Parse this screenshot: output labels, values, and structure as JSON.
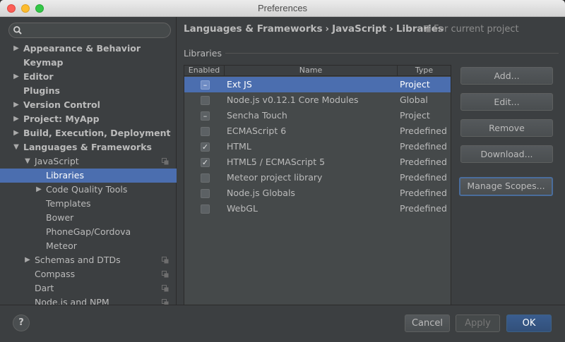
{
  "window": {
    "title": "Preferences"
  },
  "search": {
    "placeholder": "",
    "value": ""
  },
  "sidebar": {
    "items": [
      {
        "label": "Appearance & Behavior",
        "arrow": "▶",
        "bold": true,
        "indent": 0
      },
      {
        "label": "Keymap",
        "arrow": "",
        "bold": true,
        "indent": 0
      },
      {
        "label": "Editor",
        "arrow": "▶",
        "bold": true,
        "indent": 0
      },
      {
        "label": "Plugins",
        "arrow": "",
        "bold": true,
        "indent": 0
      },
      {
        "label": "Version Control",
        "arrow": "▶",
        "bold": true,
        "indent": 0
      },
      {
        "label": "Project: MyApp",
        "arrow": "▶",
        "bold": true,
        "indent": 0
      },
      {
        "label": "Build, Execution, Deployment",
        "arrow": "▶",
        "bold": true,
        "indent": 0
      },
      {
        "label": "Languages & Frameworks",
        "arrow": "▼",
        "bold": true,
        "indent": 0
      },
      {
        "label": "JavaScript",
        "arrow": "▼",
        "bold": false,
        "indent": 1,
        "scope": true
      },
      {
        "label": "Libraries",
        "arrow": "",
        "bold": false,
        "indent": 2,
        "selected": true
      },
      {
        "label": "Code Quality Tools",
        "arrow": "▶",
        "bold": false,
        "indent": 2
      },
      {
        "label": "Templates",
        "arrow": "",
        "bold": false,
        "indent": 2
      },
      {
        "label": "Bower",
        "arrow": "",
        "bold": false,
        "indent": 2
      },
      {
        "label": "PhoneGap/Cordova",
        "arrow": "",
        "bold": false,
        "indent": 2
      },
      {
        "label": "Meteor",
        "arrow": "",
        "bold": false,
        "indent": 2
      },
      {
        "label": "Schemas and DTDs",
        "arrow": "▶",
        "bold": false,
        "indent": 1,
        "scope": true
      },
      {
        "label": "Compass",
        "arrow": "",
        "bold": false,
        "indent": 1,
        "scope": true
      },
      {
        "label": "Dart",
        "arrow": "",
        "bold": false,
        "indent": 1,
        "scope": true
      },
      {
        "label": "Node.js and NPM",
        "arrow": "",
        "bold": false,
        "indent": 1,
        "scope": true
      }
    ]
  },
  "main": {
    "breadcrumb": [
      "Languages & Frameworks",
      "JavaScript",
      "Libraries"
    ],
    "breadcrumb_sep": "›",
    "project_hint": "For current project",
    "section_title": "Libraries",
    "table": {
      "columns": [
        "Enabled",
        "Name",
        "Type"
      ],
      "rows": [
        {
          "enabled": "partial",
          "name": "Ext JS",
          "type": "Project",
          "selected": true
        },
        {
          "enabled": "off",
          "name": "Node.js v0.12.1 Core Modules",
          "type": "Global"
        },
        {
          "enabled": "partial",
          "name": "Sencha Touch",
          "type": "Project"
        },
        {
          "enabled": "off",
          "name": "ECMAScript 6",
          "type": "Predefined"
        },
        {
          "enabled": "on",
          "name": "HTML",
          "type": "Predefined"
        },
        {
          "enabled": "on",
          "name": "HTML5 / ECMAScript 5",
          "type": "Predefined"
        },
        {
          "enabled": "off",
          "name": "Meteor project library",
          "type": "Predefined"
        },
        {
          "enabled": "off",
          "name": "Node.js Globals",
          "type": "Predefined"
        },
        {
          "enabled": "off",
          "name": "WebGL",
          "type": "Predefined"
        }
      ]
    },
    "buttons": {
      "add": "Add...",
      "edit": "Edit...",
      "remove": "Remove",
      "download": "Download...",
      "manage_scopes": "Manage Scopes..."
    }
  },
  "footer": {
    "help": "?",
    "cancel": "Cancel",
    "apply": "Apply",
    "ok": "OK"
  },
  "glyphs": {
    "check_on": "✓",
    "check_partial": "–",
    "check_off": ""
  },
  "colors": {
    "selection": "#4b6eaf",
    "panel": "#3c3f41",
    "text": "#bbbbbb"
  }
}
